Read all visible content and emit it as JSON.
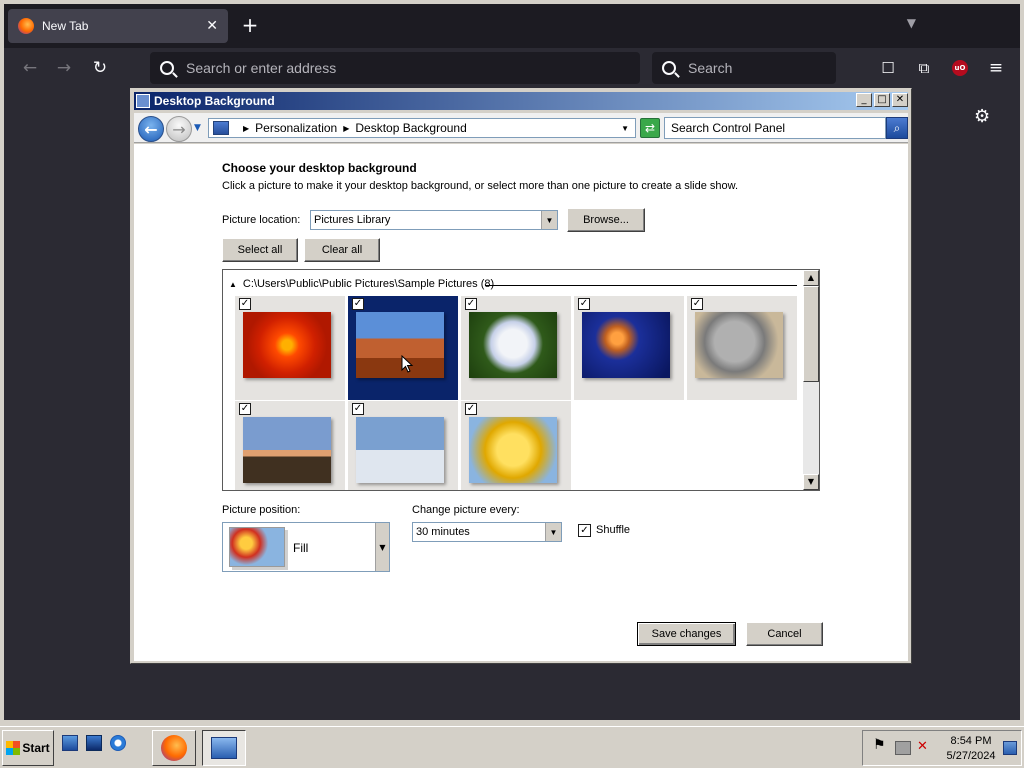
{
  "browser": {
    "tab_title": "New Tab",
    "url_placeholder": "Search or enter address",
    "search_placeholder": "Search"
  },
  "dialog": {
    "title": "Desktop Background",
    "breadcrumb": [
      "Personalization",
      "Desktop Background"
    ],
    "search_placeholder": "Search Control Panel",
    "heading": "Choose your desktop background",
    "subheading": "Click a picture to make it your desktop background, or select more than one picture to create a slide show.",
    "picture_location_label": "Picture location:",
    "picture_location_value": "Pictures Library",
    "browse_label": "Browse...",
    "select_all_label": "Select all",
    "clear_all_label": "Clear all",
    "gallery_group_label": "C:\\Users\\Public\\Public Pictures\\Sample Pictures (8)",
    "pictures": [
      {
        "name": "chrysanthemum",
        "checked": true,
        "selected": false
      },
      {
        "name": "desert",
        "checked": true,
        "selected": true
      },
      {
        "name": "hydrangeas",
        "checked": true,
        "selected": false
      },
      {
        "name": "jellyfish",
        "checked": true,
        "selected": false
      },
      {
        "name": "koala",
        "checked": true,
        "selected": false
      },
      {
        "name": "lighthouse",
        "checked": true,
        "selected": false
      },
      {
        "name": "penguins",
        "checked": true,
        "selected": false
      },
      {
        "name": "tulips",
        "checked": true,
        "selected": false
      }
    ],
    "picture_position_label": "Picture position:",
    "picture_position_value": "Fill",
    "change_every_label": "Change picture every:",
    "change_every_value": "30 minutes",
    "shuffle_label": "Shuffle",
    "shuffle_checked": true,
    "save_label": "Save changes",
    "cancel_label": "Cancel"
  },
  "taskbar": {
    "start_label": "Start",
    "time": "8:54 PM",
    "date": "5/27/2024"
  }
}
